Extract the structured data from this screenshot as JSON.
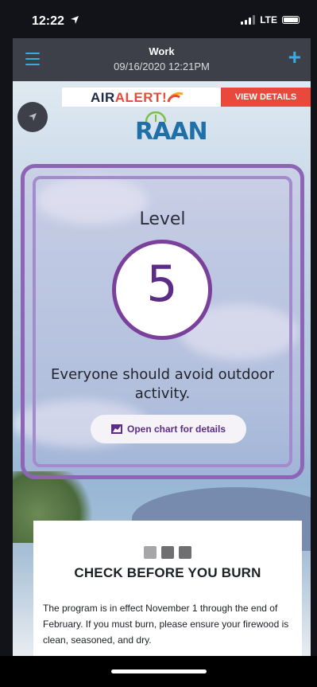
{
  "status_bar": {
    "time": "12:22",
    "network": "LTE"
  },
  "nav": {
    "title": "Work",
    "subtitle": "09/16/2020 12:21PM"
  },
  "banner": {
    "air_text": "AIR",
    "alert_text": "ALERT!",
    "view_details": "VIEW DETAILS"
  },
  "logo": {
    "text": "RAAN"
  },
  "aqi_card": {
    "level_label": "Level",
    "level_value": "5",
    "message": "Everyone should avoid outdoor activity.",
    "chart_button": "Open chart for details",
    "accent_color": "#7b3f9c"
  },
  "burn_panel": {
    "heading": "CHECK BEFORE YOU BURN",
    "body": "The program is in effect November 1 through the end of February. If you must burn, please ensure your firewood is clean, seasoned, and dry."
  }
}
